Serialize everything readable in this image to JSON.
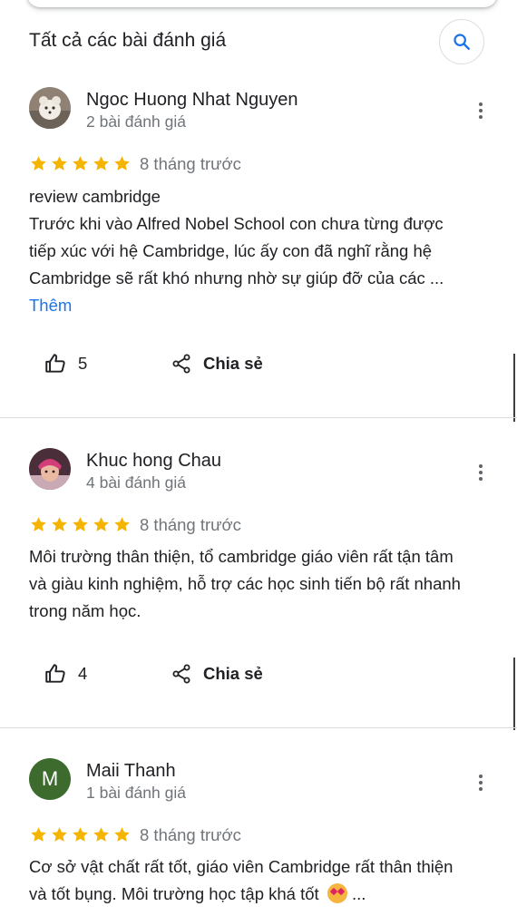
{
  "header": {
    "title": "Tất cả các bài đánh giá",
    "search_icon": "search-icon"
  },
  "reviews": [
    {
      "name": "Ngoc Huong Nhat Nguyen",
      "count": "2 bài đánh giá",
      "stars": 5,
      "date": "8 tháng trước",
      "lines": [
        "review cambridge",
        "Trước khi vào Alfred Nobel School con chưa từng được",
        "tiếp xúc với hệ Cambridge, lúc ấy con đã nghĩ rằng hệ",
        "Cambridge sẽ rất khó nhưng nhờ sự giúp đỡ của các ..."
      ],
      "more": "Thêm",
      "likes": "5",
      "share": "Chia sẻ"
    },
    {
      "name": "Khuc hong Chau",
      "count": "4 bài đánh giá",
      "stars": 5,
      "date": "8 tháng trước",
      "lines": [
        "Môi trường thân thiện, tổ cambridge giáo viên rất tận tâm",
        "và giàu kinh nghiệm, hỗ trợ các học sinh tiến bộ rất nhanh",
        "trong năm học."
      ],
      "likes": "4",
      "share": "Chia sẻ"
    },
    {
      "name": "Maii Thanh",
      "avatar_letter": "M",
      "count": "1 bài đánh giá",
      "stars": 5,
      "date": "8 tháng trước",
      "lines": [
        "Cơ sở vật chất rất tốt, giáo viên Cambridge rất thân thiện",
        "và tốt bụng. Môi trường học tập khá tốt"
      ],
      "ellipsis": "..."
    }
  ],
  "colors": {
    "star": "#f4b400",
    "link": "#1a73e8",
    "secondary_text": "#70757a",
    "avatar_m_bg": "#3c6b2d"
  }
}
